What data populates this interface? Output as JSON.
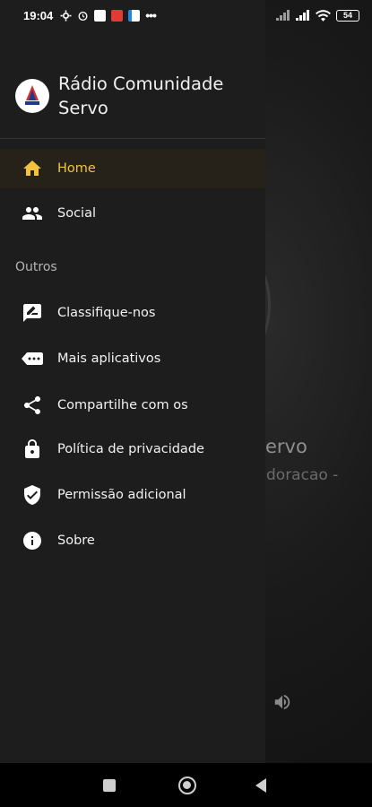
{
  "status_bar": {
    "time": "19:04",
    "battery": "54"
  },
  "drawer": {
    "app_title": "Rádio Comunidade Servo",
    "menu": [
      {
        "label": "Home",
        "icon": "home-icon",
        "active": true
      },
      {
        "label": "Social",
        "icon": "people-icon",
        "active": false
      }
    ],
    "section_label": "Outros",
    "others": [
      {
        "label": "Classifique-nos",
        "icon": "rate-review-icon"
      },
      {
        "label": "Mais aplicativos",
        "icon": "more-apps-icon"
      },
      {
        "label": "Compartilhe com os",
        "icon": "share-icon"
      },
      {
        "label": "Política de privacidade",
        "icon": "lock-icon"
      },
      {
        "label": "Permissão adicional",
        "icon": "verified-shield-icon"
      },
      {
        "label": "Sobre",
        "icon": "info-icon"
      }
    ]
  },
  "background": {
    "title_fragment": "ervo",
    "subtitle_fragment": "doracao -"
  },
  "colors": {
    "accent": "#f5c33b",
    "drawer_bg": "#1d1d1d",
    "active_bg": "#262219"
  }
}
